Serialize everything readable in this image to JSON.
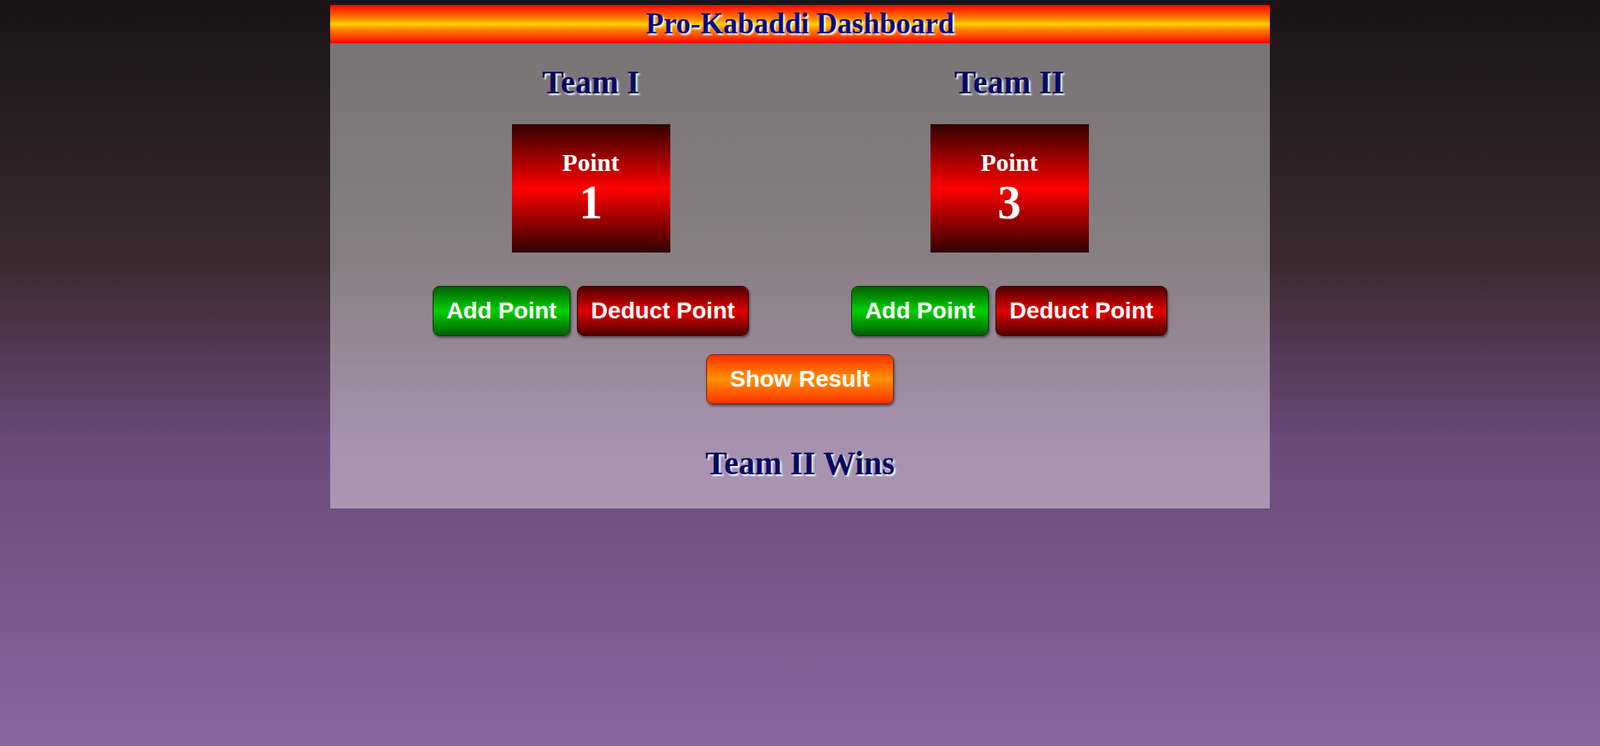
{
  "header": {
    "title": "Pro-Kabaddi Dashboard"
  },
  "teams": [
    {
      "name": "Team I",
      "label": "Point",
      "points": "1",
      "add_button": "Add Point",
      "deduct_button": "Deduct Point"
    },
    {
      "name": "Team II",
      "label": "Point",
      "points": "3",
      "add_button": "Add Point",
      "deduct_button": "Deduct Point"
    }
  ],
  "show_result_button": "Show Result",
  "result": "Team II Wins"
}
